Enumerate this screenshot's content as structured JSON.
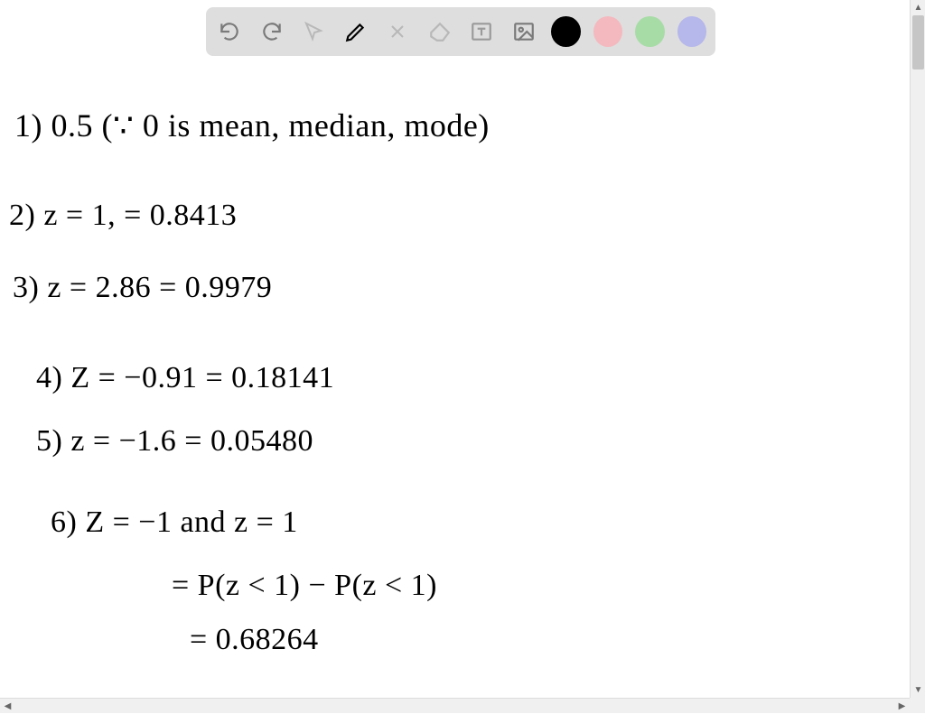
{
  "toolbar": {
    "undo_label": "Undo",
    "redo_label": "Redo",
    "select_label": "Select",
    "pen_label": "Pen",
    "tools_label": "Tools",
    "eraser_label": "Eraser",
    "text_label": "Text box",
    "image_label": "Insert image",
    "colors": {
      "black": "#000000",
      "pink": "#f4b9bf",
      "green": "#a7dca6",
      "lavender": "#b6b7ea"
    }
  },
  "notes": {
    "line1": "1)   0.5   (∵ 0 is mean, median, mode)",
    "line2": "2)   z = 1,    =  0.8413",
    "line3": "3)  z = 2.86   =   0.9979",
    "line4": "4)   Z = −0.91    =   0.18141",
    "line5": "5)    z = −1.6    =    0.05480",
    "line6": "6)   Z = −1   and   z = 1",
    "line7": "=   P(z < 1) − P(z < 1)",
    "line8": "=   0.68264"
  }
}
